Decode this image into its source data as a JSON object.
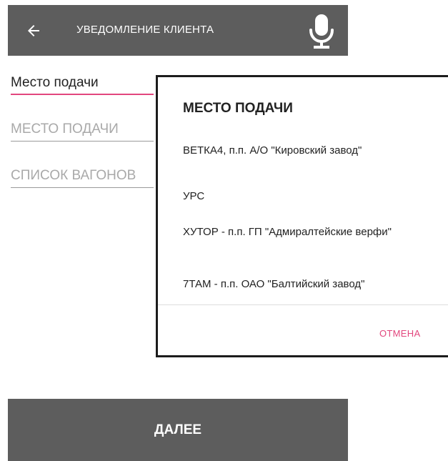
{
  "toolbar": {
    "title": "УВЕДОМЛЕНИЕ КЛИЕНТА",
    "back_icon": "arrow-left-icon",
    "mic_icon": "microphone-icon",
    "background": "#5d5d5d"
  },
  "form": {
    "field1_value": "Место подачи",
    "field2_placeholder": "МЕСТО ПОДАЧИ",
    "field3_placeholder": "СПИСОК ВАГОНОВ",
    "accent_color": "#e2477e"
  },
  "next_button": {
    "label": "ДАЛЕЕ"
  },
  "dialog": {
    "title": "МЕСТО ПОДАЧИ",
    "options": [
      "ВЕТКА4, п.п. А/О \"Кировский завод\"",
      "УРС",
      "ХУТОР - п.п. ГП \"Адмиралтейские верфи\"",
      "7ТАМ - п.п. ОАО \"Балтийский завод\""
    ],
    "cancel_label": "ОТМЕНА"
  }
}
